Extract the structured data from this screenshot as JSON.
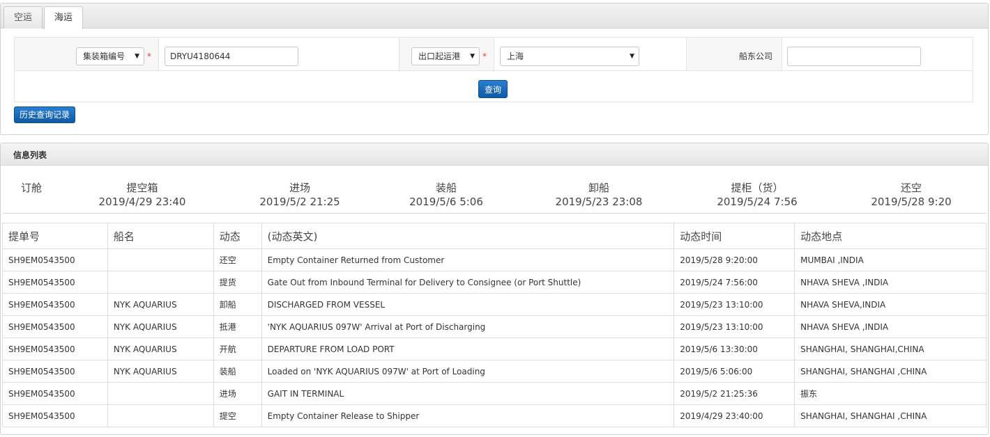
{
  "tabs": [
    {
      "label": "空运",
      "active": false
    },
    {
      "label": "海运",
      "active": true
    }
  ],
  "search": {
    "type_select": "集装箱编号",
    "container_no": "DRYU4180644",
    "port_type_select": "出口起运港",
    "port_select": "上海",
    "carrier_label": "船东公司",
    "carrier_value": "",
    "required_mark": "*",
    "query_button": "查询",
    "history_button": "历史查询记录"
  },
  "info": {
    "title": "信息列表",
    "milestones": [
      {
        "label": "订舱",
        "date": ""
      },
      {
        "label": "提空箱",
        "date": "2019/4/29 23:40"
      },
      {
        "label": "进场",
        "date": "2019/5/2 21:25"
      },
      {
        "label": "装船",
        "date": "2019/5/6 5:06"
      },
      {
        "label": "卸船",
        "date": "2019/5/23 23:08"
      },
      {
        "label": "提柜（货）",
        "date": "2019/5/24 7:56"
      },
      {
        "label": "还空",
        "date": "2019/5/28 9:20"
      }
    ]
  },
  "table": {
    "columns": [
      "提单号",
      "船名",
      "动态",
      "(动态英文)",
      "动态时间",
      "动态地点"
    ],
    "rows": [
      [
        "SH9EM0543500",
        "",
        "还空",
        "Empty Container Returned from Customer",
        "2019/5/28 9:20:00",
        "MUMBAI ,INDIA"
      ],
      [
        "SH9EM0543500",
        "",
        "提货",
        "Gate Out from Inbound Terminal for Delivery to Consignee (or Port Shuttle)",
        "2019/5/24 7:56:00",
        "NHAVA SHEVA ,INDIA"
      ],
      [
        "SH9EM0543500",
        "NYK AQUARIUS",
        "卸船",
        "DISCHARGED FROM VESSEL",
        "2019/5/23 13:10:00",
        "NHAVA SHEVA,INDIA"
      ],
      [
        "SH9EM0543500",
        "NYK AQUARIUS",
        "抵港",
        "'NYK AQUARIUS 097W' Arrival at Port of Discharging",
        "2019/5/23 13:10:00",
        "NHAVA SHEVA ,INDIA"
      ],
      [
        "SH9EM0543500",
        "NYK AQUARIUS",
        "开航",
        "DEPARTURE FROM LOAD PORT",
        "2019/5/6 13:30:00",
        "SHANGHAI, SHANGHAI,CHINA"
      ],
      [
        "SH9EM0543500",
        "NYK AQUARIUS",
        "装船",
        "Loaded on 'NYK AQUARIUS 097W' at Port of Loading",
        "2019/5/6 5:06:00",
        "SHANGHAI, SHANGHAI ,CHINA"
      ],
      [
        "SH9EM0543500",
        "",
        "进场",
        "GAIT IN TERMINAL",
        "2019/5/2 21:25:36",
        "振东"
      ],
      [
        "SH9EM0543500",
        "",
        "提空",
        "Empty Container Release to Shipper",
        "2019/4/29 23:40:00",
        "SHANGHAI, SHANGHAI ,CHINA"
      ]
    ]
  }
}
